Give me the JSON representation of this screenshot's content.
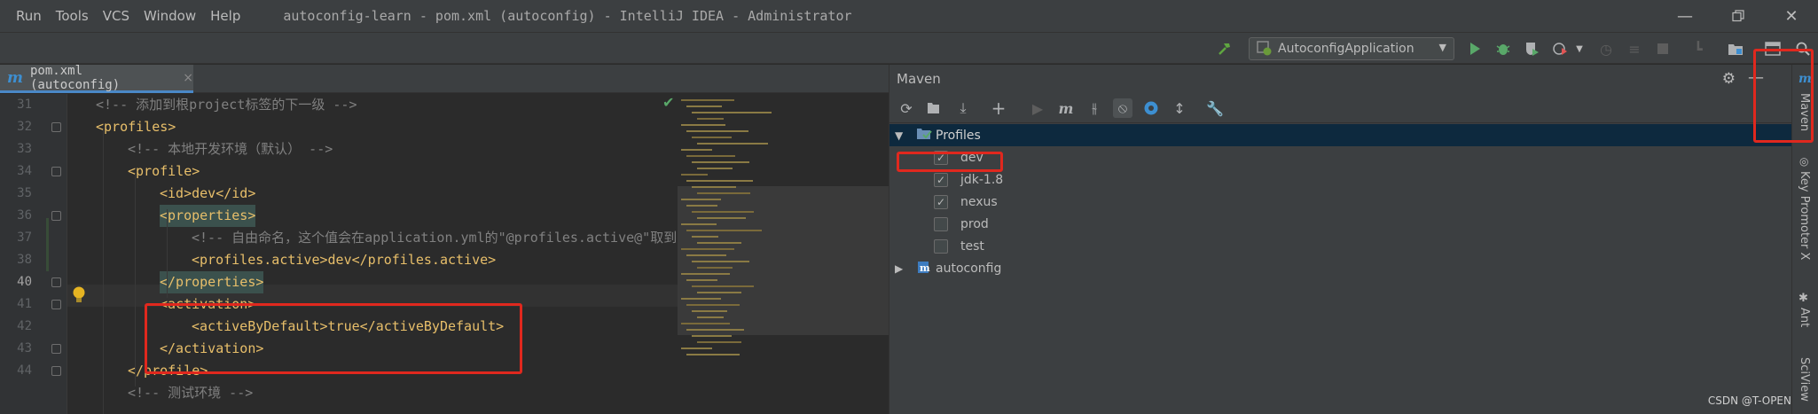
{
  "menu": [
    "Run",
    "Tools",
    "VCS",
    "Window",
    "Help"
  ],
  "window_title": "autoconfig-learn - pom.xml (autoconfig) - IntelliJ IDEA - Administrator",
  "run_config": "AutoconfigApplication",
  "editor_tab": {
    "label": "pom.xml (autoconfig)",
    "close": "×"
  },
  "editor": {
    "lines": [
      {
        "num": "31",
        "text": "<!-- 添加到根project标签的下一级 -->",
        "indent": 1,
        "kind": "comment"
      },
      {
        "num": "32",
        "text": "<profiles>",
        "indent": 1,
        "kind": "tag"
      },
      {
        "num": "33",
        "text": "<!-- 本地开发环境（默认） -->",
        "indent": 2,
        "kind": "comment"
      },
      {
        "num": "34",
        "text": "<profile>",
        "indent": 2,
        "kind": "tag"
      },
      {
        "num": "35",
        "text": "<id>dev</id>",
        "indent": 3,
        "kind": "tag"
      },
      {
        "num": "36",
        "text": "<properties>",
        "indent": 3,
        "kind": "tag-hl"
      },
      {
        "num": "37",
        "text": "<!-- 自由命名，这个值会在application.yml的\"@profiles.active@\"取到",
        "indent": 4,
        "kind": "comment"
      },
      {
        "num": "38",
        "text": "<profiles.active>dev</profiles.active>",
        "indent": 4,
        "kind": "tag"
      },
      {
        "num": "40",
        "text": "</properties>",
        "indent": 3,
        "kind": "tag-hl"
      },
      {
        "num": "41",
        "text": "<activation>",
        "indent": 3,
        "kind": "tag"
      },
      {
        "num": "42",
        "text": "<activeByDefault>true</activeByDefault>",
        "indent": 4,
        "kind": "tag"
      },
      {
        "num": "43",
        "text": "</activation>",
        "indent": 3,
        "kind": "tag"
      },
      {
        "num": "44",
        "text": "</profile>",
        "indent": 2,
        "kind": "tag"
      },
      {
        "num": "",
        "text": "<!-- 测试环境 -->",
        "indent": 2,
        "kind": "comment"
      }
    ]
  },
  "maven": {
    "title": "Maven",
    "profiles_label": "Profiles",
    "profiles": [
      {
        "name": "dev",
        "checked": true
      },
      {
        "name": "jdk-1.8",
        "checked": true
      },
      {
        "name": "nexus",
        "checked": true
      },
      {
        "name": "prod",
        "checked": false
      },
      {
        "name": "test",
        "checked": false
      }
    ],
    "project": "autoconfig"
  },
  "stripe": {
    "maven": "Maven",
    "key_promoter": "Key Promoter X",
    "ant": "Ant",
    "sciview": "SciView"
  },
  "watermark": "CSDN @T-OPEN",
  "colors": {
    "accent": "#4a88c7",
    "annotation": "#e0281e",
    "tag": "#e8bf6a",
    "comment": "#808080"
  }
}
